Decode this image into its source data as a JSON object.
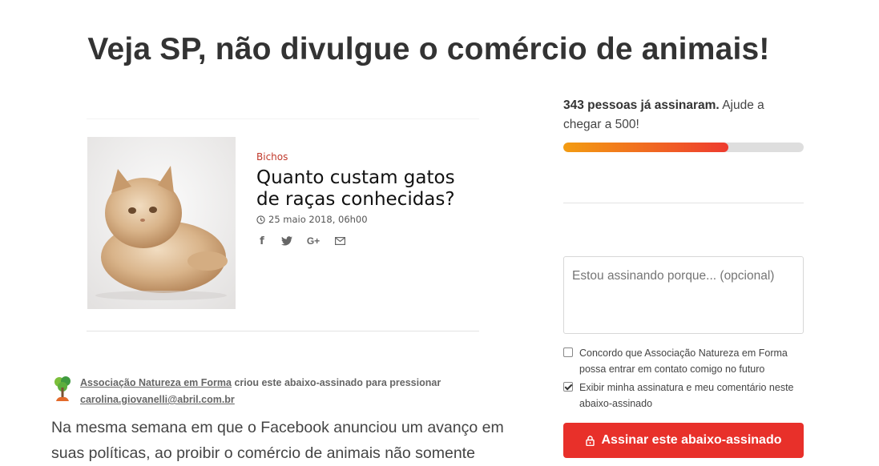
{
  "page": {
    "title": "Veja SP, não divulgue o comércio de animais!"
  },
  "article": {
    "category": "Bichos",
    "title": "Quanto custam gatos de raças conhecidas?",
    "date": "25 maio 2018, 06h00",
    "share_icons": [
      "facebook-icon",
      "twitter-icon",
      "google-plus-icon",
      "email-icon"
    ]
  },
  "creator": {
    "org_name": "Associação Natureza em Forma",
    "action_text": " criou este abaixo-assinado para pressionar",
    "target": "carolina.giovanelli@abril.com.br"
  },
  "petition": {
    "body": "Na mesma semana em que o Facebook anunciou um avanço em suas políticas, ao proibir o comércio de animais não somente"
  },
  "signatures": {
    "count_text": "343 pessoas já assinaram.",
    "goal_text": " Ajude a chegar a 500!",
    "count": 343,
    "goal": 500,
    "accent_start": "#f39c12",
    "accent_end": "#ee3b2f"
  },
  "form": {
    "reason_placeholder": "Estou assinando porque... (opcional)",
    "contact_label": "Concordo que Associação Natureza em Forma possa entrar em contato comigo no futuro",
    "contact_checked": false,
    "display_label": "Exibir minha assinatura e meu comentário neste abaixo-assinado",
    "display_checked": true,
    "sign_button_label": "Assinar este abaixo-assinado",
    "button_color": "#e8302a"
  }
}
